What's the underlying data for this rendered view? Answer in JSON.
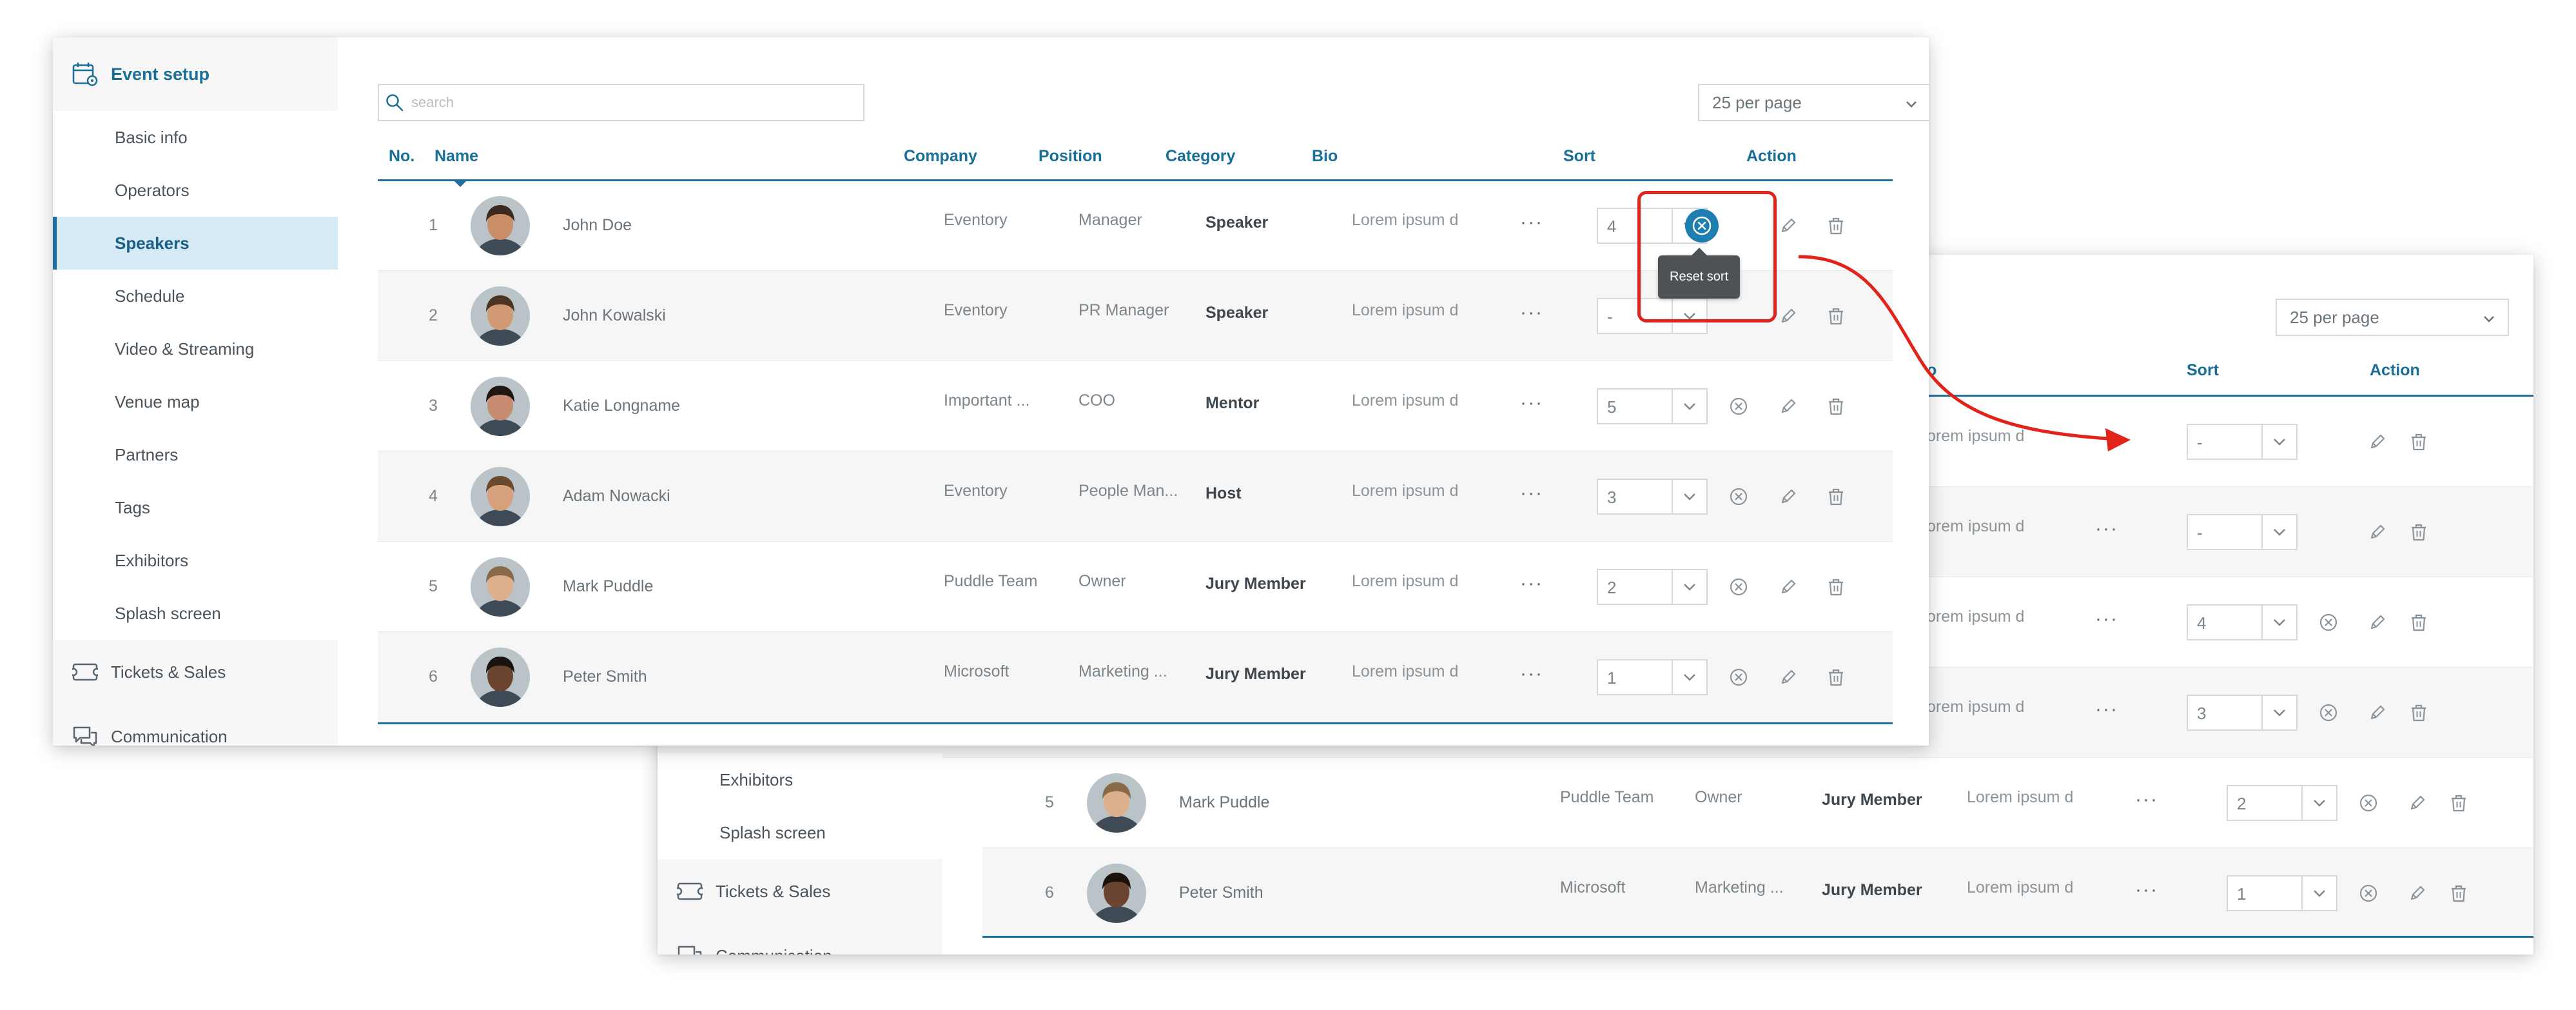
{
  "sidebar": {
    "header": {
      "label": "Event setup",
      "icon": "calendar-settings-icon"
    },
    "items": [
      {
        "label": "Basic info",
        "active": false
      },
      {
        "label": "Operators",
        "active": false
      },
      {
        "label": "Speakers",
        "active": true
      },
      {
        "label": "Schedule",
        "active": false
      },
      {
        "label": "Video & Streaming",
        "active": false
      },
      {
        "label": "Venue map",
        "active": false
      },
      {
        "label": "Partners",
        "active": false
      },
      {
        "label": "Tags",
        "active": false
      },
      {
        "label": "Exhibitors",
        "active": false
      },
      {
        "label": "Splash screen",
        "active": false
      }
    ],
    "sections": [
      {
        "label": "Tickets & Sales",
        "icon": "ticket-icon"
      },
      {
        "label": "Communication",
        "icon": "chat-bubbles-icon"
      }
    ]
  },
  "search": {
    "placeholder": "search"
  },
  "pagination": {
    "per_page": "25 per page"
  },
  "table": {
    "columns": {
      "no": "No.",
      "name": "Name",
      "company": "Company",
      "position": "Position",
      "category": "Category",
      "bio": "Bio",
      "sort": "Sort",
      "action": "Action"
    },
    "rows": [
      {
        "no": "1",
        "name": "John Doe",
        "company": "Eventory",
        "position": "Manager",
        "category": "Speaker",
        "bio": "Lorem ipsum d",
        "more": "···",
        "sort": "4"
      },
      {
        "no": "2",
        "name": "John Kowalski",
        "company": "Eventory",
        "position": "PR Manager",
        "category": "Speaker",
        "bio": "Lorem ipsum d",
        "more": "···",
        "sort": "-"
      },
      {
        "no": "3",
        "name": "Katie Longname",
        "company": "Important ...",
        "position": "COO",
        "category": "Mentor",
        "bio": "Lorem ipsum d",
        "more": "···",
        "sort": "5"
      },
      {
        "no": "4",
        "name": "Adam Nowacki",
        "company": "Eventory",
        "position": "People Man...",
        "category": "Host",
        "bio": "Lorem ipsum d",
        "more": "···",
        "sort": "3"
      },
      {
        "no": "5",
        "name": "Mark Puddle",
        "company": "Puddle Team",
        "position": "Owner",
        "category": "Jury Member",
        "bio": "Lorem ipsum d",
        "more": "···",
        "sort": "2"
      },
      {
        "no": "6",
        "name": "Peter Smith",
        "company": "Microsoft",
        "position": "Marketing ...",
        "category": "Jury Member",
        "bio": "Lorem ipsum d",
        "more": "···",
        "sort": "1"
      }
    ]
  },
  "tooltip": {
    "label": "Reset sort"
  },
  "back_panel": {
    "sidebar_items": [
      {
        "label": "Exhibitors"
      },
      {
        "label": "Splash screen"
      }
    ],
    "sections": [
      {
        "label": "Tickets & Sales"
      },
      {
        "label": "Communication"
      }
    ],
    "per_page": "25 per page",
    "columns": {
      "bio_partial": "o",
      "sort": "Sort",
      "action": "Action"
    },
    "partial_rows": [
      {
        "bio": "orem ipsum d",
        "more": "",
        "sort": "-"
      },
      {
        "bio": "orem ipsum d",
        "more": "···",
        "sort": "-"
      },
      {
        "bio": "orem ipsum d",
        "more": "···",
        "sort": "4"
      },
      {
        "bio": "orem ipsum d",
        "more": "···",
        "sort": "3"
      }
    ],
    "rows": [
      {
        "no": "5",
        "name": "Mark Puddle",
        "company": "Puddle Team",
        "position": "Owner",
        "category": "Jury Member",
        "bio": "Lorem ipsum d",
        "more": "···",
        "sort": "2"
      },
      {
        "no": "6",
        "name": "Peter Smith",
        "company": "Microsoft",
        "position": "Marketing ...",
        "category": "Jury Member",
        "bio": "Lorem ipsum d",
        "more": "···",
        "sort": "1"
      }
    ]
  },
  "colors": {
    "accent": "#1f6f9c",
    "active_bg": "#d5eaf5",
    "highlight": "#e2231a",
    "tooltip_bg": "#4d5257"
  }
}
